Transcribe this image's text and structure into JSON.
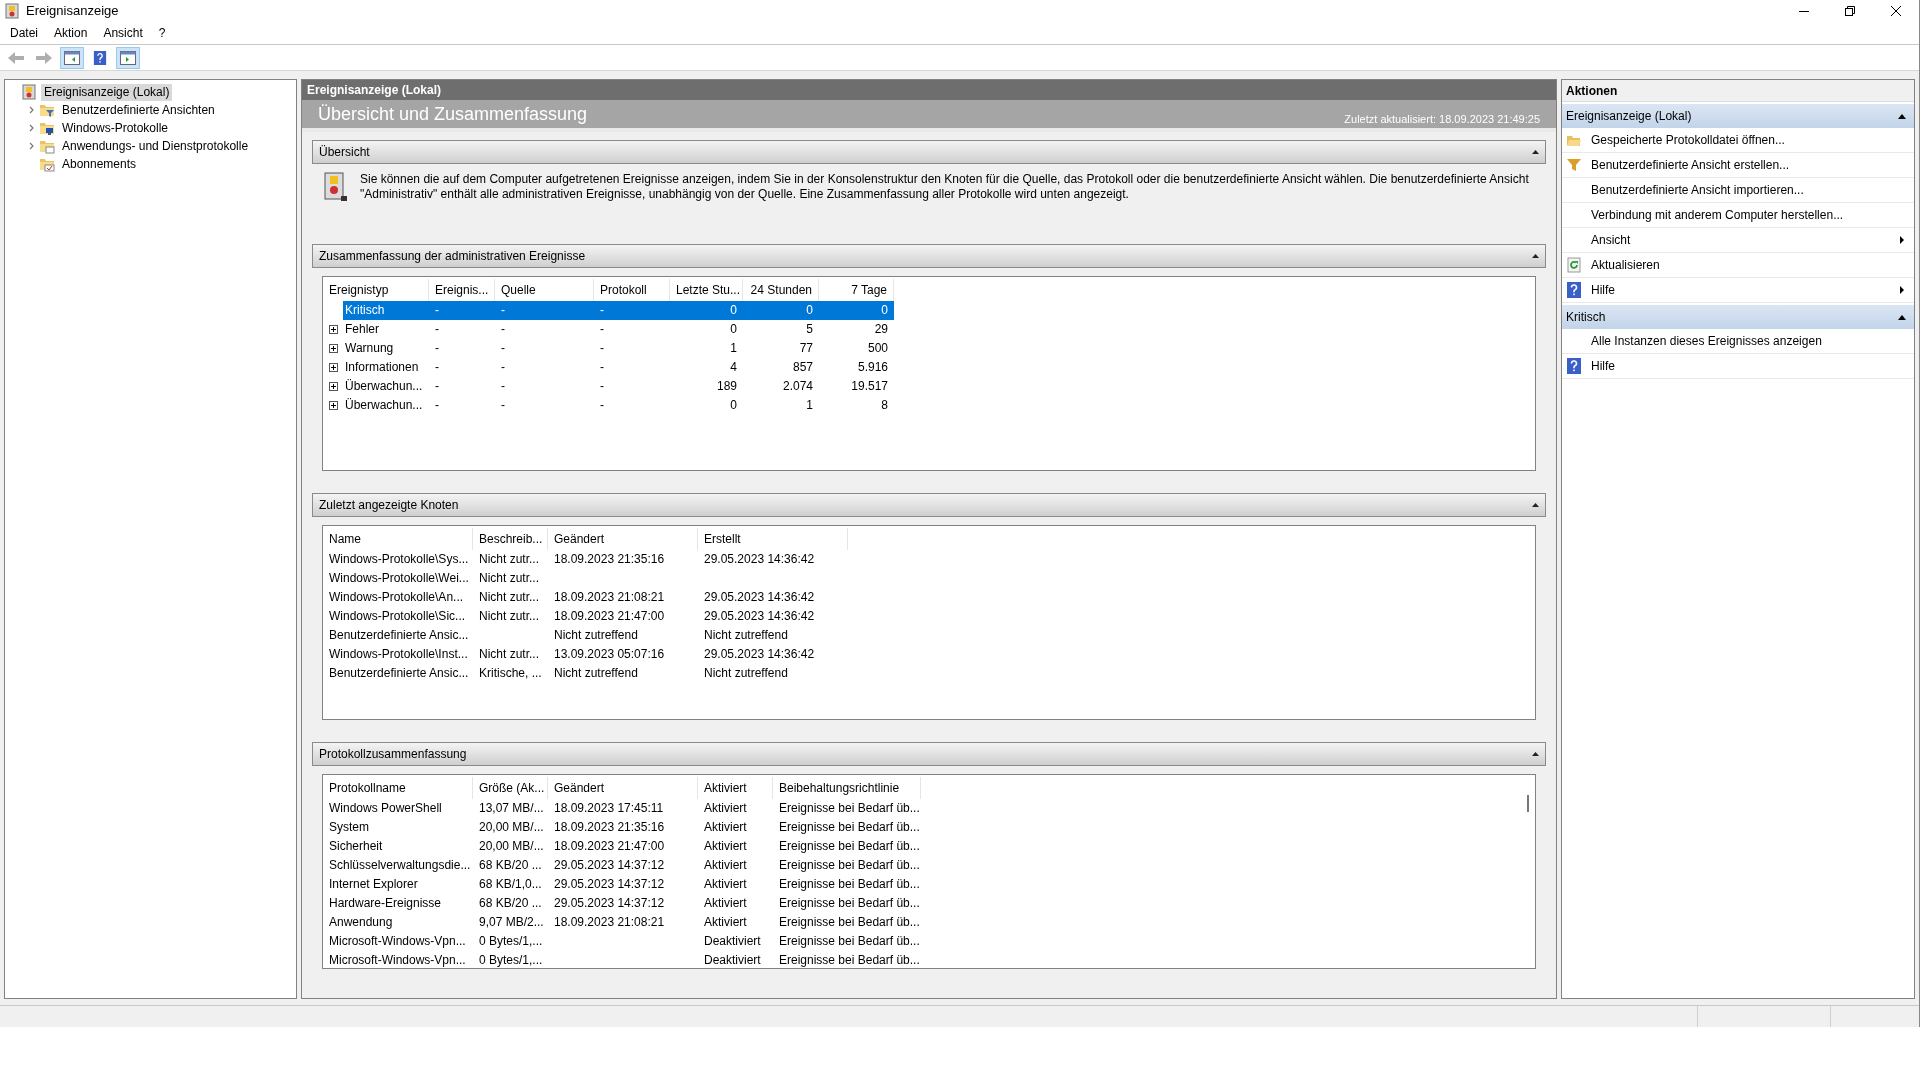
{
  "window": {
    "title": "Ereignisanzeige"
  },
  "menu": [
    "Datei",
    "Aktion",
    "Ansicht",
    "?"
  ],
  "toolbar": [
    {
      "kind": "back",
      "pressed": false,
      "disabled": true
    },
    {
      "kind": "forward",
      "pressed": false,
      "disabled": true
    },
    {
      "kind": "tree",
      "pressed": true,
      "disabled": false
    },
    {
      "kind": "help",
      "pressed": false,
      "disabled": false
    },
    {
      "kind": "pane",
      "pressed": true,
      "disabled": false
    }
  ],
  "tree": [
    {
      "label": "Ereignisanzeige (Lokal)",
      "kind": "viewer",
      "selected": true,
      "expandable": false,
      "children": [
        {
          "label": "Benutzerdefinierte Ansichten",
          "kind": "filterfolder",
          "selected": false,
          "expandable": true
        },
        {
          "label": "Windows-Protokolle",
          "kind": "pcfolder",
          "selected": false,
          "expandable": true
        },
        {
          "label": "Anwendungs- und Dienstprotokolle",
          "kind": "folder",
          "selected": false,
          "expandable": true
        },
        {
          "label": "Abonnements",
          "kind": "subfolder",
          "selected": false,
          "expandable": false
        }
      ]
    }
  ],
  "center": {
    "header": "Ereignisanzeige (Lokal)",
    "title": "Übersicht und Zusammenfassung",
    "updated": "Zuletzt aktualisiert: 18.09.2023 21:49:25",
    "overview": {
      "title": "Übersicht",
      "text": "Sie können die auf dem Computer aufgetretenen Ereignisse anzeigen, indem Sie in der Konsolenstruktur den Knoten für die Quelle, das Protokoll oder die benutzerdefinierte Ansicht wählen. Die benutzerdefinierte Ansicht \"Administrativ\" enthält alle administrativen Ereignisse, unabhängig von der Quelle. Eine Zusammenfassung aller Protokolle wird unten angezeigt."
    },
    "summary": {
      "title": "Zusammenfassung der administrativen Ereignisse",
      "columns": [
        "Ereignistyp",
        "Ereignis...",
        "Quelle",
        "Protokoll",
        "Letzte Stu...",
        "24 Stunden",
        "7 Tage"
      ],
      "rows": [
        {
          "cells": [
            "Kritisch",
            "-",
            "-",
            "-",
            "0",
            "0",
            "0"
          ],
          "selected": true,
          "expandable": false
        },
        {
          "cells": [
            "Fehler",
            "-",
            "-",
            "-",
            "0",
            "5",
            "29"
          ],
          "selected": false,
          "expandable": true
        },
        {
          "cells": [
            "Warnung",
            "-",
            "-",
            "-",
            "1",
            "77",
            "500"
          ],
          "selected": false,
          "expandable": true
        },
        {
          "cells": [
            "Informationen",
            "-",
            "-",
            "-",
            "4",
            "857",
            "5.916"
          ],
          "selected": false,
          "expandable": true
        },
        {
          "cells": [
            "Überwachun...",
            "-",
            "-",
            "-",
            "189",
            "2.074",
            "19.517"
          ],
          "selected": false,
          "expandable": true
        },
        {
          "cells": [
            "Überwachun...",
            "-",
            "-",
            "-",
            "0",
            "1",
            "8"
          ],
          "selected": false,
          "expandable": true
        }
      ]
    },
    "recent": {
      "title": "Zuletzt angezeigte Knoten",
      "columns": [
        "Name",
        "Beschreib...",
        "Geändert",
        "Erstellt"
      ],
      "rows": [
        [
          "Windows-Protokolle\\Sys...",
          "Nicht zutr...",
          "18.09.2023 21:35:16",
          "29.05.2023 14:36:42"
        ],
        [
          "Windows-Protokolle\\Wei...",
          "Nicht zutr...",
          "",
          ""
        ],
        [
          "Windows-Protokolle\\An...",
          "Nicht zutr...",
          "18.09.2023 21:08:21",
          "29.05.2023 14:36:42"
        ],
        [
          "Windows-Protokolle\\Sic...",
          "Nicht zutr...",
          "18.09.2023 21:47:00",
          "29.05.2023 14:36:42"
        ],
        [
          "Benutzerdefinierte Ansic...",
          "",
          "Nicht zutreffend",
          "Nicht zutreffend"
        ],
        [
          "Windows-Protokolle\\Inst...",
          "Nicht zutr...",
          "13.09.2023 05:07:16",
          "29.05.2023 14:36:42"
        ],
        [
          "Benutzerdefinierte Ansic...",
          "Kritische, ...",
          "Nicht zutreffend",
          "Nicht zutreffend"
        ]
      ]
    },
    "logs": {
      "title": "Protokollzusammenfassung",
      "columns": [
        "Protokollname",
        "Größe (Ak...",
        "Geändert",
        "Aktiviert",
        "Beibehaltungsrichtlinie"
      ],
      "rows": [
        [
          "Windows PowerShell",
          "13,07 MB/...",
          "18.09.2023 17:45:11",
          "Aktiviert",
          "Ereignisse bei Bedarf üb..."
        ],
        [
          "System",
          "20,00 MB/...",
          "18.09.2023 21:35:16",
          "Aktiviert",
          "Ereignisse bei Bedarf üb..."
        ],
        [
          "Sicherheit",
          "20,00 MB/...",
          "18.09.2023 21:47:00",
          "Aktiviert",
          "Ereignisse bei Bedarf üb..."
        ],
        [
          "Schlüsselverwaltungsdie...",
          "68 KB/20 ...",
          "29.05.2023 14:37:12",
          "Aktiviert",
          "Ereignisse bei Bedarf üb..."
        ],
        [
          "Internet Explorer",
          "68 KB/1,0...",
          "29.05.2023 14:37:12",
          "Aktiviert",
          "Ereignisse bei Bedarf üb..."
        ],
        [
          "Hardware-Ereignisse",
          "68 KB/20 ...",
          "29.05.2023 14:37:12",
          "Aktiviert",
          "Ereignisse bei Bedarf üb..."
        ],
        [
          "Anwendung",
          "9,07 MB/2...",
          "18.09.2023 21:08:21",
          "Aktiviert",
          "Ereignisse bei Bedarf üb..."
        ],
        [
          "Microsoft-Windows-Vpn...",
          "0 Bytes/1,...",
          "",
          "Deaktiviert",
          "Ereignisse bei Bedarf üb..."
        ],
        [
          "Microsoft-Windows-Vpn...",
          "0 Bytes/1,...",
          "",
          "Deaktiviert",
          "Ereignisse bei Bedarf üb..."
        ]
      ]
    }
  },
  "actions": {
    "title": "Aktionen",
    "groups": [
      {
        "title": "Ereignisanzeige (Lokal)",
        "items": [
          {
            "label": "Gespeicherte Protokolldatei öffnen...",
            "kind": "folder",
            "submenu": false
          },
          {
            "label": "Benutzerdefinierte Ansicht erstellen...",
            "kind": "filter",
            "submenu": false
          },
          {
            "label": "Benutzerdefinierte Ansicht importieren...",
            "kind": "plain",
            "submenu": false
          },
          {
            "label": "Verbindung mit anderem Computer herstellen...",
            "kind": "plain",
            "submenu": false
          },
          {
            "label": "Ansicht",
            "kind": "plain",
            "submenu": true
          },
          {
            "label": "Aktualisieren",
            "kind": "refresh",
            "submenu": false
          },
          {
            "label": "Hilfe",
            "kind": "help",
            "submenu": true
          }
        ]
      },
      {
        "title": "Kritisch",
        "items": [
          {
            "label": "Alle Instanzen dieses Ereignisses anzeigen",
            "kind": "plain",
            "submenu": false
          },
          {
            "label": "Hilfe",
            "kind": "help",
            "submenu": false
          }
        ]
      }
    ]
  }
}
